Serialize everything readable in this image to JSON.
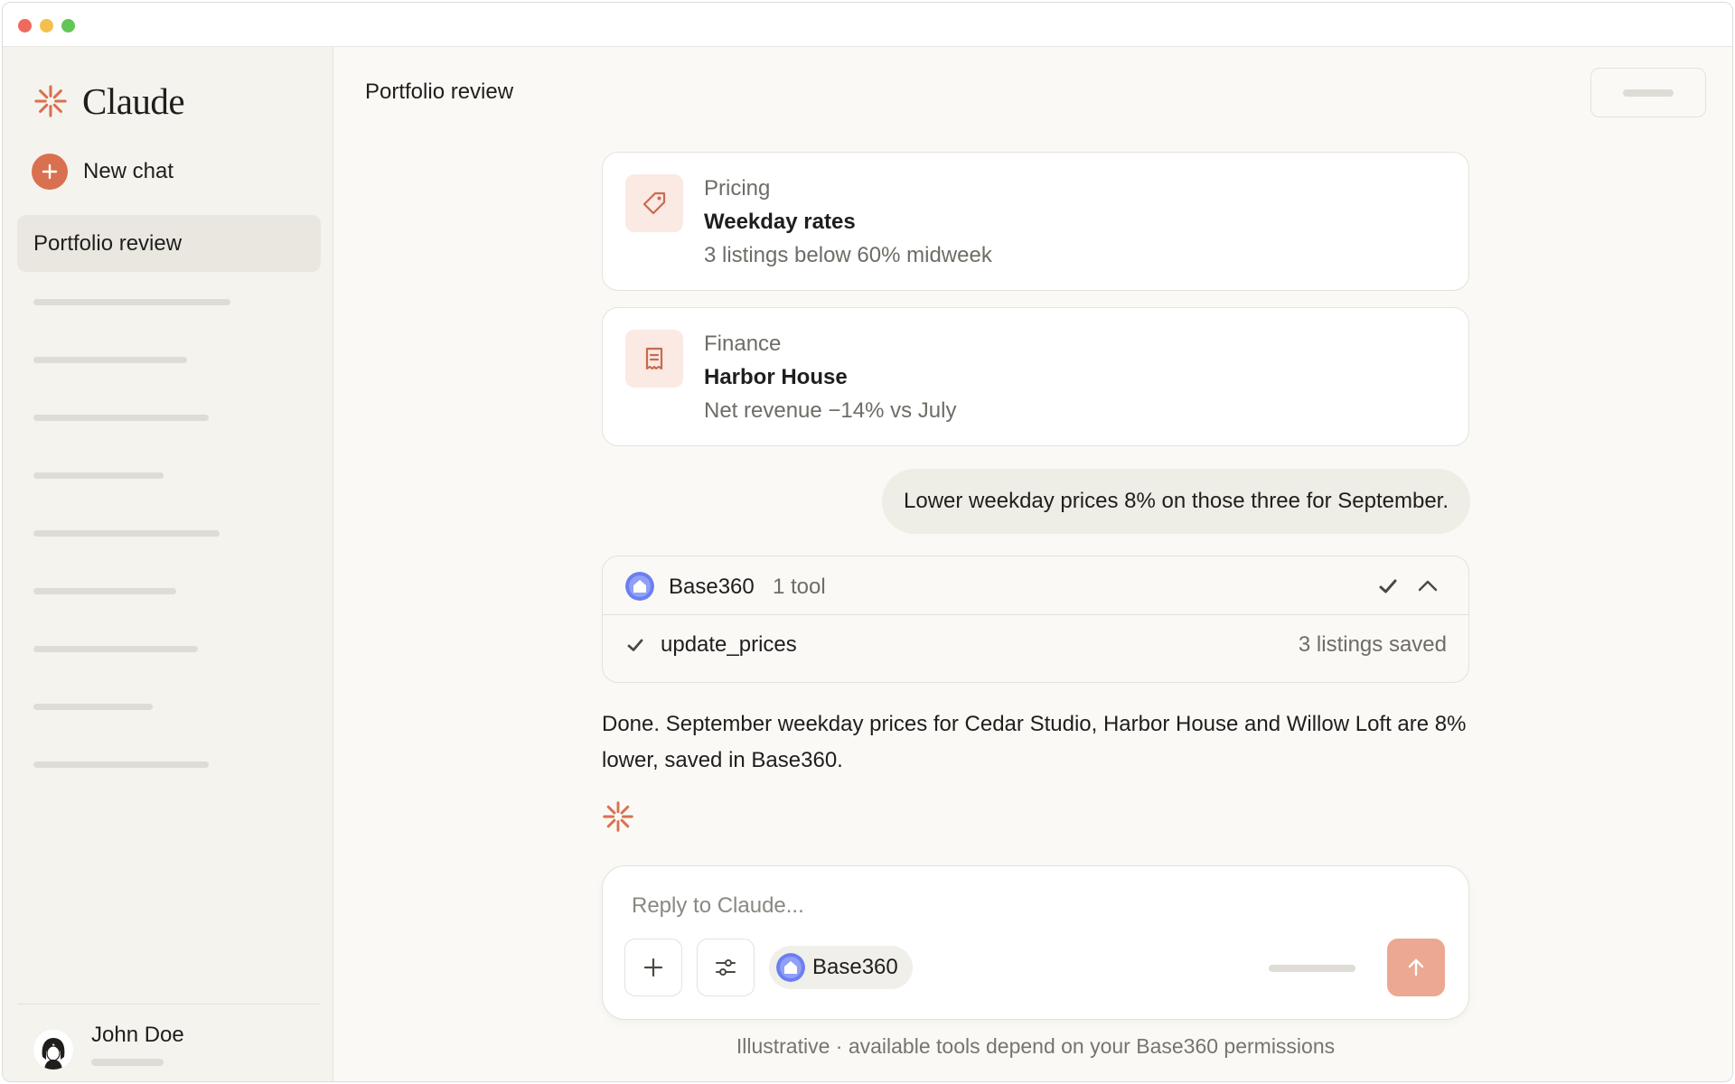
{
  "window": {
    "controls": [
      "close",
      "minimize",
      "maximize"
    ]
  },
  "sidebar": {
    "brand": {
      "name": "Claude",
      "icon": "claude-spark-icon"
    },
    "new_chat_label": "New chat",
    "active_item": "Portfolio review",
    "user": {
      "name": "John Doe"
    }
  },
  "header": {
    "title": "Portfolio review"
  },
  "cards": [
    {
      "category": "Pricing",
      "title": "Weekday rates",
      "description": "3 listings below 60% midweek",
      "icon": "tag-icon"
    },
    {
      "category": "Finance",
      "title": "Harbor House",
      "description": "Net revenue −14% vs July",
      "icon": "receipt-icon"
    }
  ],
  "user_message": "Lower weekday prices 8% on those three for September.",
  "tool_use": {
    "name": "Base360",
    "count_label": "1 tool",
    "rows": [
      {
        "name": "update_prices",
        "status": "3 listings saved"
      }
    ]
  },
  "assistant_reply": "Done. September weekday prices for Cedar Studio, Harbor House and Willow Loft are 8% lower, saved in Base360.",
  "composer": {
    "placeholder": "Reply to Claude...",
    "chip_label": "Base360"
  },
  "footnote": "Illustrative · available tools depend on your Base360 permissions",
  "colors": {
    "accent": "#d9704f",
    "send_button": "#eca891",
    "base360_brand": "#6b7ff0",
    "background": "#faf9f5",
    "sidebar": "#f4f3ee"
  }
}
